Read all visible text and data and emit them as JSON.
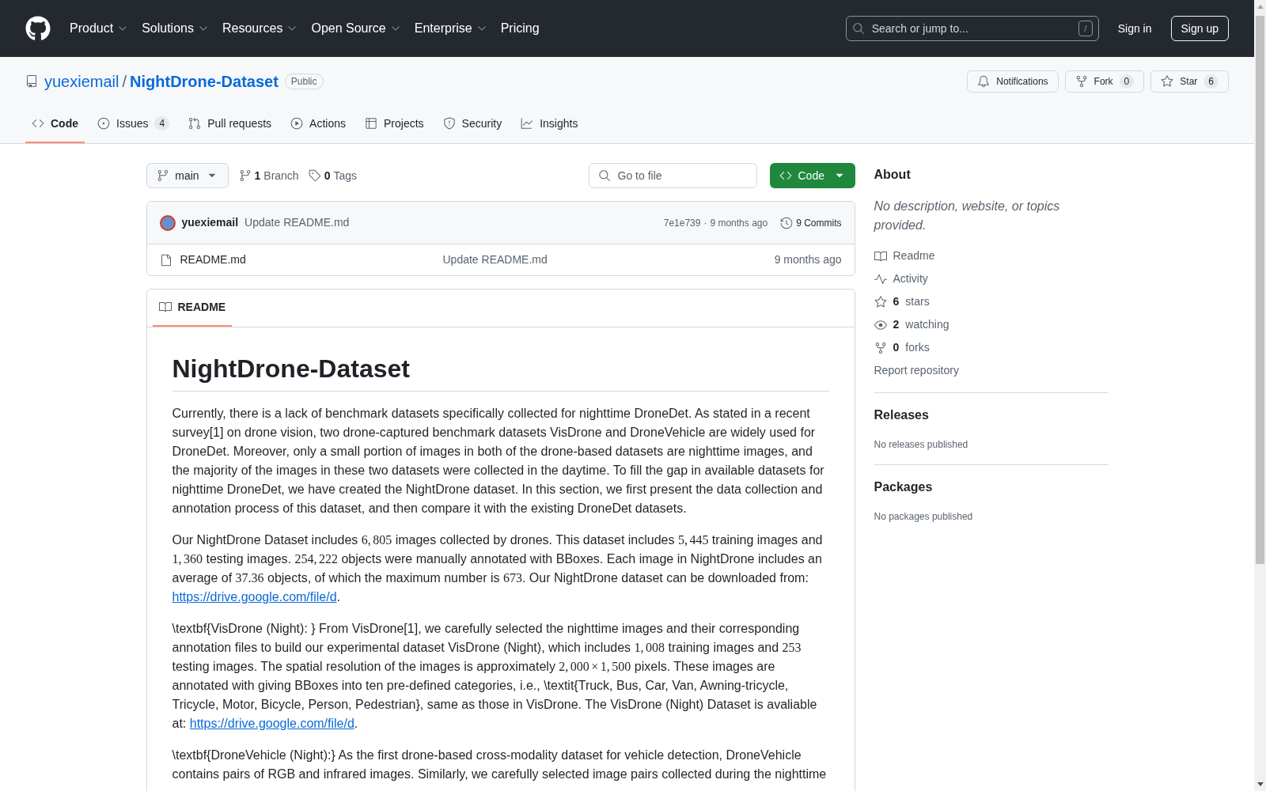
{
  "header": {
    "nav": [
      {
        "label": "Product",
        "dropdown": true
      },
      {
        "label": "Solutions",
        "dropdown": true
      },
      {
        "label": "Resources",
        "dropdown": true
      },
      {
        "label": "Open Source",
        "dropdown": true
      },
      {
        "label": "Enterprise",
        "dropdown": true
      },
      {
        "label": "Pricing",
        "dropdown": false
      }
    ],
    "search": {
      "placeholder": "Search or jump to...",
      "shortcut": "/"
    },
    "sign_in": "Sign in",
    "sign_up": "Sign up"
  },
  "repo": {
    "owner": "yuexiemail",
    "separator": "/",
    "name": "NightDrone-Dataset",
    "visibility": "Public",
    "actions": [
      {
        "kind": "notifications",
        "label": "Notifications"
      },
      {
        "kind": "fork",
        "label": "Fork",
        "count": "0"
      },
      {
        "kind": "star",
        "label": "Star",
        "count": "6"
      }
    ]
  },
  "tabs": [
    {
      "kind": "code",
      "label": "Code",
      "selected": true
    },
    {
      "kind": "issues",
      "label": "Issues",
      "count": "4",
      "selected": false
    },
    {
      "kind": "pulls",
      "label": "Pull requests",
      "selected": false
    },
    {
      "kind": "actions",
      "label": "Actions",
      "selected": false
    },
    {
      "kind": "projects",
      "label": "Projects",
      "selected": false
    },
    {
      "kind": "security",
      "label": "Security",
      "selected": false
    },
    {
      "kind": "insights",
      "label": "Insights",
      "selected": false
    }
  ],
  "toolbar": {
    "branch": "main",
    "branch_count": {
      "count": "1",
      "label": "Branch"
    },
    "tag_count": {
      "count": "0",
      "label": "Tags"
    },
    "file_search": {
      "placeholder": "Go to file"
    },
    "code_button": "Code"
  },
  "latest_commit": {
    "author": "yuexiemail",
    "message": "Update README.md",
    "hash": "7e1e739",
    "separator": "·",
    "time": "9 months ago",
    "commits": "9 Commits"
  },
  "files": [
    {
      "kind": "file",
      "name": "README.md",
      "message": "Update README.md",
      "time": "9 months ago"
    }
  ],
  "readme": {
    "tab": {
      "label": "README",
      "selected": true
    },
    "title": "NightDrone-Dataset",
    "paragraphs": [
      [
        {
          "kind": "text",
          "text": "Currently, there is a lack of benchmark datasets specifically collected for nighttime DroneDet. As stated in a recent survey[1] on drone vision, two drone-captured benchmark datasets VisDrone and DroneVehicle are widely used for DroneDet. Moreover, only a small portion of images in both of the drone-based datasets are nighttime images, and the majority of the images in these two datasets were collected in the daytime. To fill the gap in available datasets for nighttime DroneDet, we have created the NightDrone dataset. In this section, we first present the data collection and annotation process of this dataset, and then compare it with the existing DroneDet datasets."
        }
      ],
      [
        {
          "kind": "text",
          "text": "Our NightDrone Dataset includes "
        },
        {
          "kind": "math",
          "text": "6, 805"
        },
        {
          "kind": "text",
          "text": " images collected by drones. This dataset includes "
        },
        {
          "kind": "math",
          "text": "5, 445"
        },
        {
          "kind": "text",
          "text": " training images and "
        },
        {
          "kind": "math",
          "text": "1, 360"
        },
        {
          "kind": "text",
          "text": " testing images. "
        },
        {
          "kind": "math",
          "text": "254, 222"
        },
        {
          "kind": "text",
          "text": " objects were manually annotated with BBoxes. Each image in NightDrone includes an average of "
        },
        {
          "kind": "math",
          "text": "37.36"
        },
        {
          "kind": "text",
          "text": " objects, of which the maximum number is "
        },
        {
          "kind": "math",
          "text": "673"
        },
        {
          "kind": "text",
          "text": ". Our NightDrone dataset can be downloaded from: "
        },
        {
          "kind": "link",
          "text": "https://drive.google.com/file/d"
        },
        {
          "kind": "text",
          "text": "."
        }
      ],
      [
        {
          "kind": "text",
          "text": "\\textbf{VisDrone (Night): } From VisDrone[1], we carefully selected the nighttime images and their corresponding annotation files to build our experimental dataset VisDrone (Night), which includes "
        },
        {
          "kind": "math",
          "text": "1, 008"
        },
        {
          "kind": "text",
          "text": " training images and "
        },
        {
          "kind": "math",
          "text": "253"
        },
        {
          "kind": "text",
          "text": " testing images. The spatial resolution of the images is approximately "
        },
        {
          "kind": "math",
          "text": "2, 000 × 1, 500"
        },
        {
          "kind": "text",
          "text": " pixels. These images are annotated with giving BBoxes into ten pre-defined categories, i.e., \\textit{Truck, Bus, Car, Van, Awning-tricycle, Tricycle, Motor, Bicycle, Person, Pedestrian}, same as those in VisDrone. The VisDrone (Night) Dataset is avaliable at: "
        },
        {
          "kind": "link",
          "text": "https://drive.google.com/file/d"
        },
        {
          "kind": "text",
          "text": "."
        }
      ],
      [
        {
          "kind": "text",
          "text": "\\textbf{DroneVehicle (Night):} As the first drone-based cross-modality dataset for vehicle detection, DroneVehicle contains pairs of RGB and infrared images. Similarly, we carefully selected image pairs collected during the nighttime"
        }
      ]
    ]
  },
  "about": {
    "title": "About",
    "description": "No description, website, or topics provided.",
    "links": [
      {
        "kind": "readme",
        "label": "Readme"
      },
      {
        "kind": "activity",
        "label": "Activity"
      },
      {
        "kind": "stars",
        "count": "6",
        "label": "stars"
      },
      {
        "kind": "watching",
        "count": "2",
        "label": "watching"
      },
      {
        "kind": "forks",
        "count": "0",
        "label": "forks"
      }
    ],
    "report": "Report repository"
  },
  "releases": {
    "title": "Releases",
    "note": "No releases published"
  },
  "packages": {
    "title": "Packages",
    "note": "No packages published"
  }
}
